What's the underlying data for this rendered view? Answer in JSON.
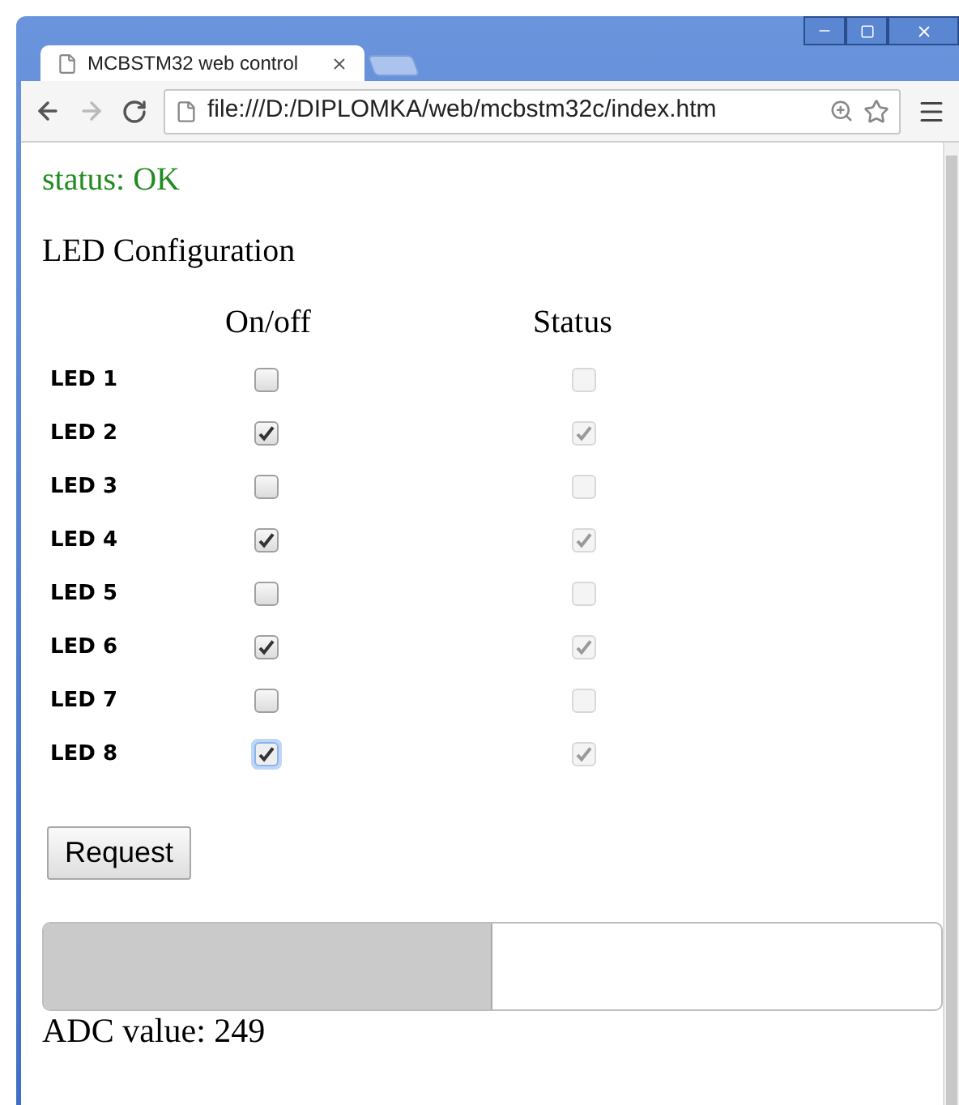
{
  "browser": {
    "tab_title": "MCBSTM32 web control",
    "address": "file:///D:/DIPLOMKA/web/mcbstm32c/index.htm"
  },
  "status": "status: OK",
  "heading": "LED Configuration",
  "columns": [
    "On/off",
    "Status"
  ],
  "leds": [
    {
      "label": "LED 1",
      "on": false,
      "status": false,
      "focused": false
    },
    {
      "label": "LED 2",
      "on": true,
      "status": true,
      "focused": false
    },
    {
      "label": "LED 3",
      "on": false,
      "status": false,
      "focused": false
    },
    {
      "label": "LED 4",
      "on": true,
      "status": true,
      "focused": false
    },
    {
      "label": "LED 5",
      "on": false,
      "status": false,
      "focused": false
    },
    {
      "label": "LED 6",
      "on": true,
      "status": true,
      "focused": false
    },
    {
      "label": "LED 7",
      "on": false,
      "status": false,
      "focused": false
    },
    {
      "label": "LED 8",
      "on": true,
      "status": true,
      "focused": true
    }
  ],
  "button": "Request",
  "adc": {
    "level": 0.5,
    "label": "ADC value: 249"
  }
}
